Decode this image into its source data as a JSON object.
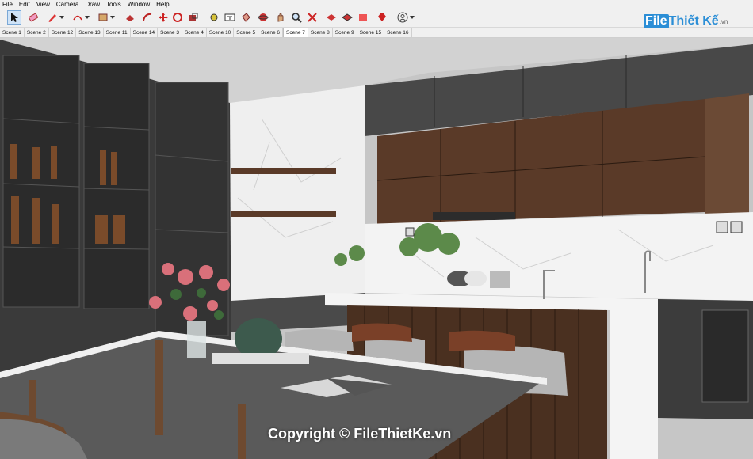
{
  "menu": [
    "File",
    "Edit",
    "View",
    "Camera",
    "Draw",
    "Tools",
    "Window",
    "Help"
  ],
  "toolbar_icons": [
    "select-arrow-icon",
    "eraser-icon",
    "pencil-line-icon",
    "arc-icon",
    "rectangle-icon",
    "push-pull-icon",
    "follow-me-icon",
    "move-icon",
    "rotate-icon",
    "scale-icon",
    "tape-measure-icon",
    "text-tool-icon",
    "paint-bucket-icon",
    "orbit-icon",
    "pan-icon",
    "zoom-icon",
    "zoom-extents-icon",
    "warehouse-icon",
    "extension-warehouse-icon",
    "layout-icon",
    "ruby-console-icon",
    "account-icon"
  ],
  "scenes": [
    "Scene 1",
    "Scene 2",
    "Scene 12",
    "Scene 13",
    "Scene 11",
    "Scene 14",
    "Scene 3",
    "Scene 4",
    "Scene 10",
    "Scene 5",
    "Scene 6",
    "Scene 7",
    "Scene 8",
    "Scene 9",
    "Scene 15",
    "Scene 16"
  ],
  "active_scene": "Scene 7",
  "watermark": {
    "logo_f": "File",
    "logo_rest": "Thiết Kế",
    "logo_domain": ".vn",
    "copyright": "Copyright © FileThietKe.vn"
  },
  "colors": {
    "toolbar_bg": "#f0f0f0",
    "cabinet_dark": "#3a3a3a",
    "wood": "#5a3a28",
    "marble": "#f2f2f2",
    "table_top": "#5a5a5a"
  }
}
